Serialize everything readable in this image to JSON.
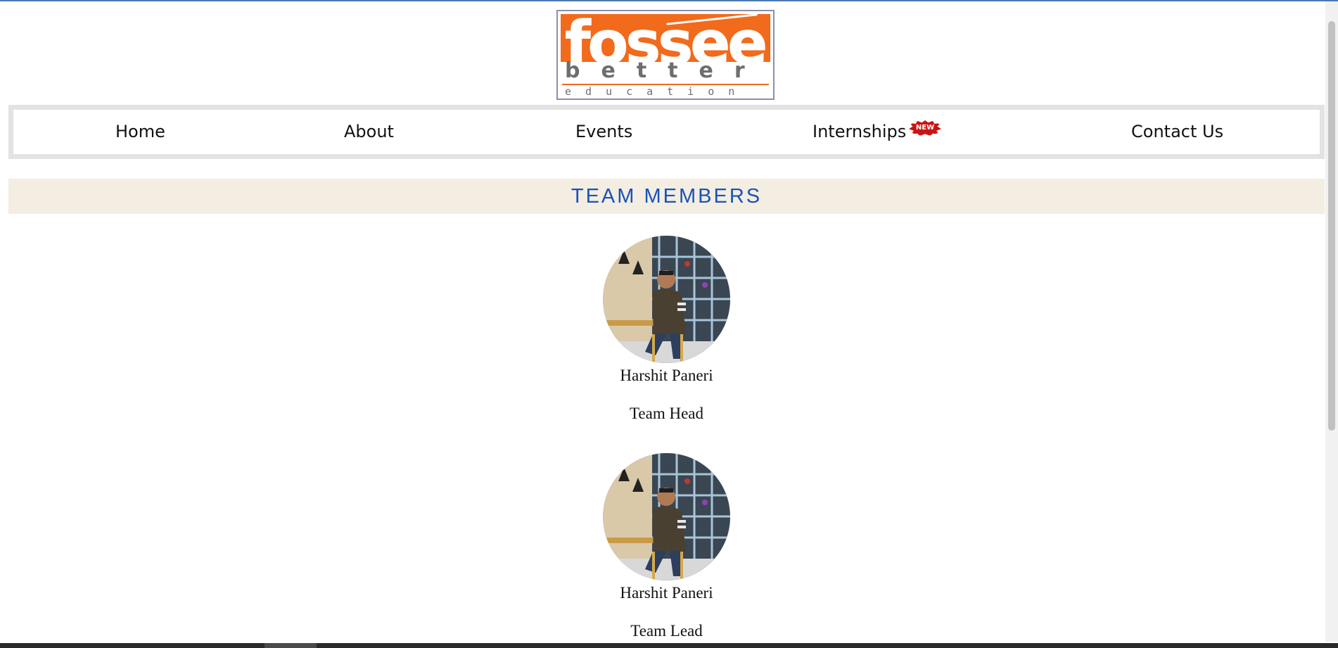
{
  "logo": {
    "word": "fossee",
    "tagline_1": "better",
    "tagline_2": "education"
  },
  "nav": {
    "items": [
      {
        "label": "Home"
      },
      {
        "label": "About"
      },
      {
        "label": "Events"
      },
      {
        "label": "Internships",
        "badge": "NEW"
      },
      {
        "label": "Contact Us"
      }
    ]
  },
  "section": {
    "title": "TEAM MEMBERS"
  },
  "members": [
    {
      "name": "Harshit Paneri",
      "role": "Team Head"
    },
    {
      "name": "Harshit Paneri",
      "role": "Team Lead"
    }
  ],
  "colors": {
    "brand_orange": "#f26a1b",
    "heading_blue": "#1a52b8",
    "section_bg": "#f3eee1",
    "badge_red": "#c81414"
  }
}
